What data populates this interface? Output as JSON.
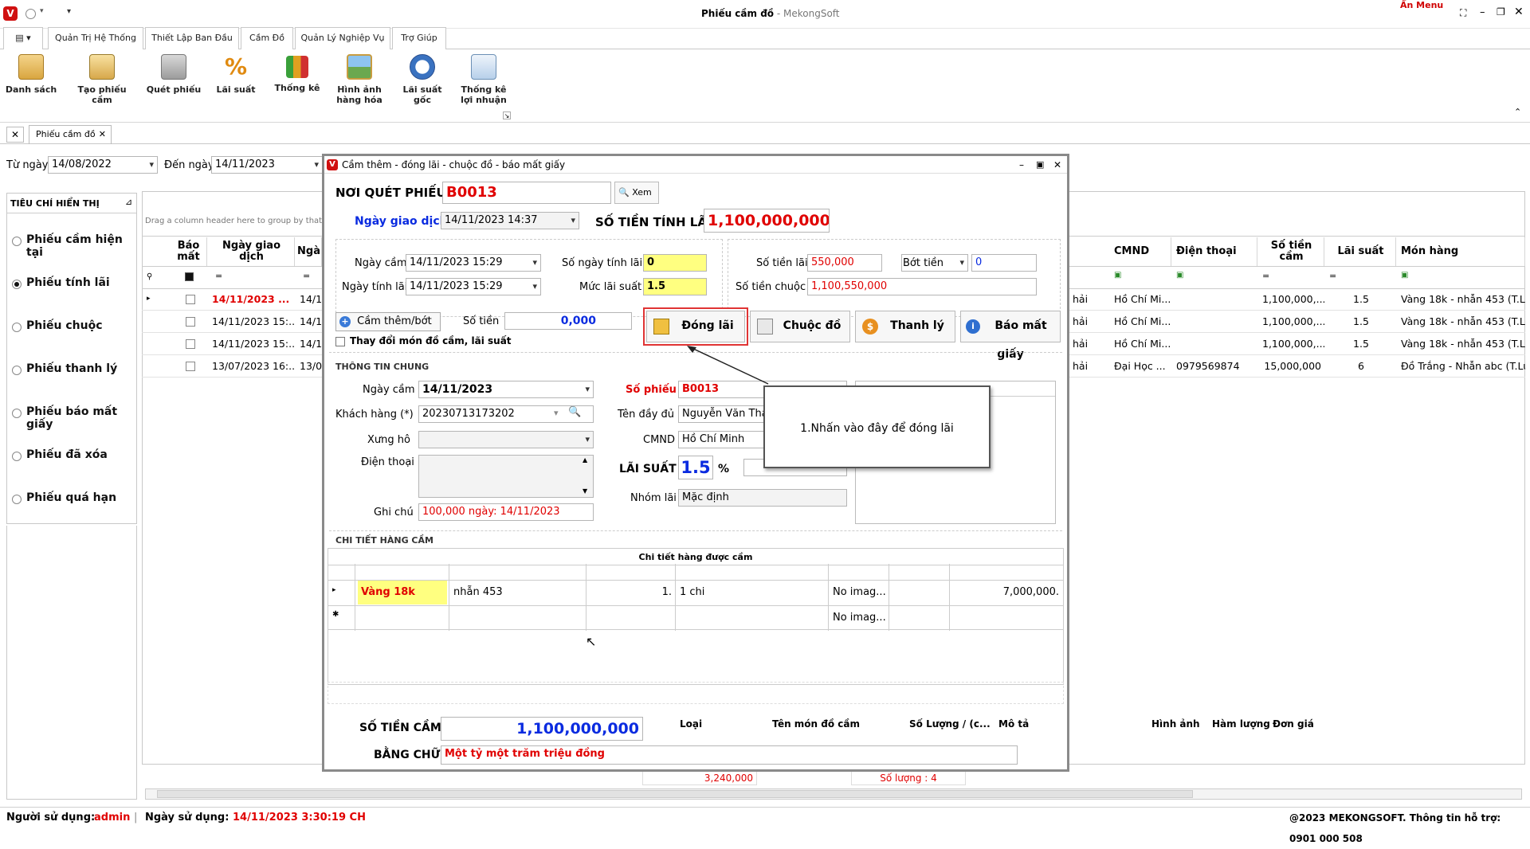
{
  "window": {
    "title": "Phiếu cầm đồ",
    "brand": "MekongSoft",
    "an_menu": "Ẩn Menu"
  },
  "ribbon_tabs": [
    "Quản Trị Hệ Thống",
    "Thiết Lập Ban Đầu",
    "Cầm Đồ",
    "Quản Lý Nghiệp Vụ",
    "Trợ Giúp"
  ],
  "ribbon_buttons": [
    {
      "label": "Danh sách",
      "icon": "clipboard-icon"
    },
    {
      "label": "Tạo phiếu cầm",
      "icon": "create-ticket-icon"
    },
    {
      "label": "Quét phiếu",
      "icon": "scan-icon"
    },
    {
      "label": "Lãi suất",
      "icon": "percent-icon"
    },
    {
      "label": "Thống kê",
      "icon": "chart-icon"
    },
    {
      "label": "Hình ảnh hàng hóa",
      "icon": "image-icon"
    },
    {
      "label": "Lãi suất gốc",
      "icon": "gauge-icon"
    },
    {
      "label": "Thống kê lợi nhuận",
      "icon": "report-icon"
    }
  ],
  "doc_tab": "Phiếu cầm đồ",
  "filter": {
    "from_label": "Từ ngày",
    "from_value": "14/08/2022",
    "to_label": "Đến ngày",
    "to_value": "14/11/2023"
  },
  "sidebar": {
    "title": "TIÊU CHÍ HIỂN THỊ",
    "items": [
      "Phiếu cầm hiện tại",
      "Phiếu tính lãi",
      "Phiếu chuộc",
      "Phiếu thanh lý",
      "Phiếu báo mất giấy",
      "Phiếu đã xóa",
      "Phiếu quá hạn"
    ],
    "selected": 1
  },
  "grid": {
    "group_hint": "Drag a column header here to group by that c",
    "left_headers": [
      "Báo mất",
      "Ngày giao dịch",
      "Ngà"
    ],
    "right_headers": [
      "CMND",
      "Điện thoại",
      "Số tiền cầm",
      "Lãi suất",
      "Món hàng"
    ],
    "rows": [
      {
        "date": "14/11/2023 ...",
        "d2": "14/1",
        "frag": "hải",
        "cmnd": "Hồ Chí Mi...",
        "phone": "",
        "amount": "1,100,000,...",
        "rate": "1.5",
        "item": "Vàng 18k - nhẫn 453 (T.Lu"
      },
      {
        "date": "14/11/2023 15:...",
        "d2": "14/1",
        "frag": "hải",
        "cmnd": "Hồ Chí Mi...",
        "phone": "",
        "amount": "1,100,000,...",
        "rate": "1.5",
        "item": "Vàng 18k - nhẫn 453 (T.Lu"
      },
      {
        "date": "14/11/2023 15:...",
        "d2": "14/1",
        "frag": "hải",
        "cmnd": "Hồ Chí Mi...",
        "phone": "",
        "amount": "1,100,000,...",
        "rate": "1.5",
        "item": "Vàng 18k - nhẫn 453 (T.Lu"
      },
      {
        "date": "13/07/2023 16:...",
        "d2": "13/0",
        "frag": "hải",
        "cmnd": "Đại Học ...",
        "phone": "0979569874",
        "amount": "15,000,000",
        "rate": "6",
        "item": "Đồ Trắng - Nhẫn abc (T.Lu"
      }
    ],
    "footer_total": "3,240,000",
    "footer_count": "Số lượng : 4"
  },
  "dialog": {
    "title": "Cầm thêm - đóng lãi - chuộc đồ - báo mất giấy",
    "scan_label": "NƠI QUÉT PHIẾU",
    "scan_value": "B0013",
    "view_btn": "Xem",
    "trans_date_label": "Ngày giao dịch",
    "trans_date": "14/11/2023 14:37",
    "interest_base_label": "SỐ TIỀN TÍNH LÃI",
    "interest_base": "1,100,000,000",
    "pawn_date_label": "Ngày cầm",
    "pawn_date": "14/11/2023 15:29",
    "calc_date_label": "Ngày tính lãi",
    "calc_date": "14/11/2023 15:29",
    "days_label": "Số ngày tính lãi",
    "days": "0",
    "rate_label": "Mức lãi suất",
    "rate": "1.5",
    "interest_label": "Số tiền lãi",
    "interest": "550,000",
    "discount_label": "Bớt tiền",
    "discount": "0",
    "redeem_label": "Số tiền chuộc",
    "redeem": "1,100,550,000",
    "add_btn": "Cầm thêm/bớt",
    "amount_label": "Số tiền",
    "amount": "0,000",
    "change_chk": "Thay đổi món đồ cầm, lãi suất",
    "btn_dong_lai": "Đóng lãi",
    "btn_chuoc": "Chuộc đồ",
    "btn_thanh_ly": "Thanh lý",
    "btn_bao_mat": "Báo mất giấy",
    "general_title": "THÔNG TIN CHUNG",
    "g_pawn_date_label": "Ngày cầm",
    "g_pawn_date": "14/11/2023",
    "customer_label": "Khách hàng (*)",
    "customer": "20230713173202",
    "title_label": "Xưng hô",
    "phone_label": "Điện thoại",
    "note_label": "Ghi chú",
    "note": "100,000 ngày: 14/11/2023",
    "ticket_label": "Số phiếu",
    "ticket": "B0013",
    "fullname_label": "Tên đầy đủ",
    "fullname": "Nguyễn Văn Thả",
    "cmnd_label": "CMND",
    "cmnd": "Hồ Chí Minh",
    "laisuat_label": "LÃI SUẤT",
    "laisuat": "1.5",
    "percent": "%",
    "group_label": "Nhóm lãi",
    "group": "Mặc định",
    "detail_title": "CHI TIẾT HÀNG CẦM",
    "detail_caption": "Chi tiết hàng được cầm",
    "detail_headers": [
      "Loại",
      "Tên món đồ cầm",
      "Số Lượng / (c...",
      "Mô tả",
      "Hình ảnh",
      "Hàm lượng (T...",
      "Đơn giá"
    ],
    "detail_row": {
      "type": "Vàng 18k",
      "name": "nhẫn 453",
      "qty": "1.",
      "desc": "1 chi",
      "img": "No imag...",
      "purity": "",
      "price": "7,000,000."
    },
    "detail_new_img": "No imag...",
    "total_label": "SỐ TIỀN CẦM",
    "total": "1,100,000,000",
    "words_label": "BẰNG CHỮ",
    "words": "Một tỷ một trăm triệu đồng"
  },
  "callout": "1.Nhấn vào đây để đóng lãi",
  "status": {
    "user_label": "Người sử dụng:",
    "user": "admin",
    "date_label": "Ngày sử dụng:",
    "date": "14/11/2023 3:30:19 CH",
    "copyright": "@2023 MEKONGSOFT. Thông tin hỗ trợ: 0901 000 508"
  },
  "colors": {
    "accent_red": "#e00000",
    "accent_blue": "#0a2be0",
    "highlight_yellow": "#ffff80"
  }
}
